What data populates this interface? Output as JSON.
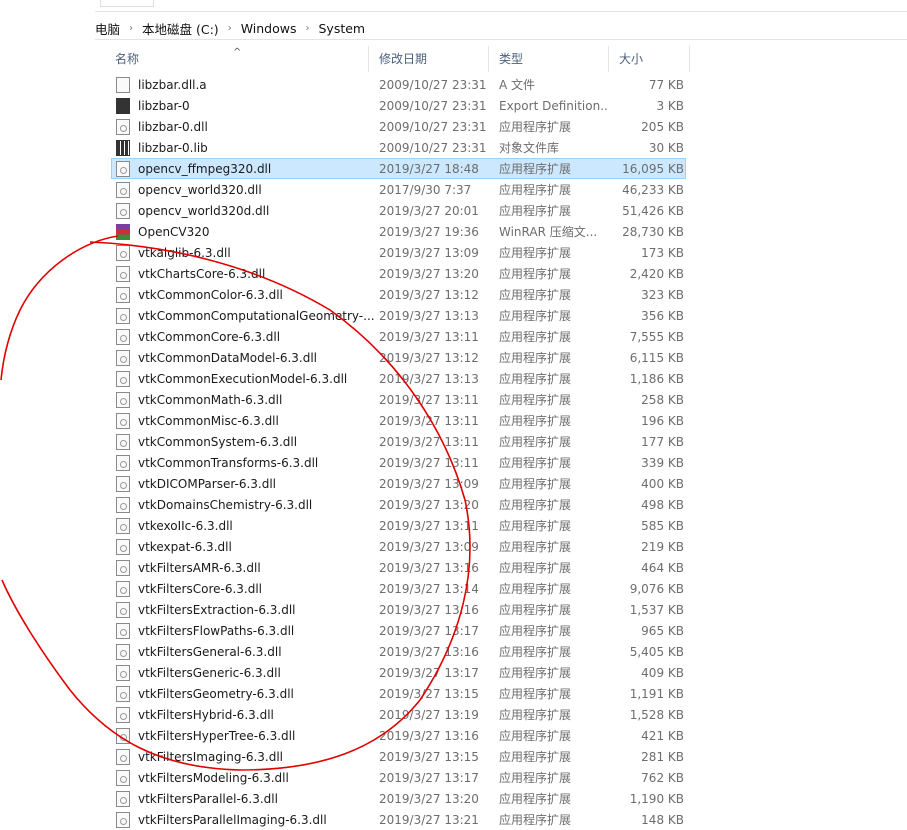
{
  "breadcrumb": [
    "电脑",
    "本地磁盘 (C:)",
    "Windows",
    "System"
  ],
  "columns": {
    "name": "名称",
    "date": "修改日期",
    "type": "类型",
    "size": "大小"
  },
  "files": [
    {
      "name": "libzbar.dll.a",
      "date": "2009/10/27 23:31",
      "type": "A 文件",
      "size": "77 KB",
      "icon": "file"
    },
    {
      "name": "libzbar-0",
      "date": "2009/10/27 23:31",
      "type": "Export Definition...",
      "size": "3 KB",
      "icon": "def"
    },
    {
      "name": "libzbar-0.dll",
      "date": "2009/10/27 23:31",
      "type": "应用程序扩展",
      "size": "205 KB",
      "icon": "dll"
    },
    {
      "name": "libzbar-0.lib",
      "date": "2009/10/27 23:31",
      "type": "对象文件库",
      "size": "30 KB",
      "icon": "lib"
    },
    {
      "name": "opencv_ffmpeg320.dll",
      "date": "2019/3/27 18:48",
      "type": "应用程序扩展",
      "size": "16,095 KB",
      "icon": "dll",
      "selected": true
    },
    {
      "name": "opencv_world320.dll",
      "date": "2017/9/30 7:37",
      "type": "应用程序扩展",
      "size": "46,233 KB",
      "icon": "dll"
    },
    {
      "name": "opencv_world320d.dll",
      "date": "2019/3/27 20:01",
      "type": "应用程序扩展",
      "size": "51,426 KB",
      "icon": "dll"
    },
    {
      "name": "OpenCV320",
      "date": "2019/3/27 19:36",
      "type": "WinRAR 压缩文...",
      "size": "28,730 KB",
      "icon": "rar"
    },
    {
      "name": "vtkalglib-6.3.dll",
      "date": "2019/3/27 13:09",
      "type": "应用程序扩展",
      "size": "173 KB",
      "icon": "dll"
    },
    {
      "name": "vtkChartsCore-6.3.dll",
      "date": "2019/3/27 13:20",
      "type": "应用程序扩展",
      "size": "2,420 KB",
      "icon": "dll"
    },
    {
      "name": "vtkCommonColor-6.3.dll",
      "date": "2019/3/27 13:12",
      "type": "应用程序扩展",
      "size": "323 KB",
      "icon": "dll"
    },
    {
      "name": "vtkCommonComputationalGeometry-...",
      "date": "2019/3/27 13:13",
      "type": "应用程序扩展",
      "size": "356 KB",
      "icon": "dll"
    },
    {
      "name": "vtkCommonCore-6.3.dll",
      "date": "2019/3/27 13:11",
      "type": "应用程序扩展",
      "size": "7,555 KB",
      "icon": "dll"
    },
    {
      "name": "vtkCommonDataModel-6.3.dll",
      "date": "2019/3/27 13:12",
      "type": "应用程序扩展",
      "size": "6,115 KB",
      "icon": "dll"
    },
    {
      "name": "vtkCommonExecutionModel-6.3.dll",
      "date": "2019/3/27 13:13",
      "type": "应用程序扩展",
      "size": "1,186 KB",
      "icon": "dll"
    },
    {
      "name": "vtkCommonMath-6.3.dll",
      "date": "2019/3/27 13:11",
      "type": "应用程序扩展",
      "size": "258 KB",
      "icon": "dll"
    },
    {
      "name": "vtkCommonMisc-6.3.dll",
      "date": "2019/3/27 13:11",
      "type": "应用程序扩展",
      "size": "196 KB",
      "icon": "dll"
    },
    {
      "name": "vtkCommonSystem-6.3.dll",
      "date": "2019/3/27 13:11",
      "type": "应用程序扩展",
      "size": "177 KB",
      "icon": "dll"
    },
    {
      "name": "vtkCommonTransforms-6.3.dll",
      "date": "2019/3/27 13:11",
      "type": "应用程序扩展",
      "size": "339 KB",
      "icon": "dll"
    },
    {
      "name": "vtkDICOMParser-6.3.dll",
      "date": "2019/3/27 13:09",
      "type": "应用程序扩展",
      "size": "400 KB",
      "icon": "dll"
    },
    {
      "name": "vtkDomainsChemistry-6.3.dll",
      "date": "2019/3/27 13:20",
      "type": "应用程序扩展",
      "size": "498 KB",
      "icon": "dll"
    },
    {
      "name": "vtkexoIIc-6.3.dll",
      "date": "2019/3/27 13:11",
      "type": "应用程序扩展",
      "size": "585 KB",
      "icon": "dll"
    },
    {
      "name": "vtkexpat-6.3.dll",
      "date": "2019/3/27 13:09",
      "type": "应用程序扩展",
      "size": "219 KB",
      "icon": "dll"
    },
    {
      "name": "vtkFiltersAMR-6.3.dll",
      "date": "2019/3/27 13:16",
      "type": "应用程序扩展",
      "size": "464 KB",
      "icon": "dll"
    },
    {
      "name": "vtkFiltersCore-6.3.dll",
      "date": "2019/3/27 13:14",
      "type": "应用程序扩展",
      "size": "9,076 KB",
      "icon": "dll"
    },
    {
      "name": "vtkFiltersExtraction-6.3.dll",
      "date": "2019/3/27 13:16",
      "type": "应用程序扩展",
      "size": "1,537 KB",
      "icon": "dll"
    },
    {
      "name": "vtkFiltersFlowPaths-6.3.dll",
      "date": "2019/3/27 13:17",
      "type": "应用程序扩展",
      "size": "965 KB",
      "icon": "dll"
    },
    {
      "name": "vtkFiltersGeneral-6.3.dll",
      "date": "2019/3/27 13:16",
      "type": "应用程序扩展",
      "size": "5,405 KB",
      "icon": "dll"
    },
    {
      "name": "vtkFiltersGeneric-6.3.dll",
      "date": "2019/3/27 13:17",
      "type": "应用程序扩展",
      "size": "409 KB",
      "icon": "dll"
    },
    {
      "name": "vtkFiltersGeometry-6.3.dll",
      "date": "2019/3/27 13:15",
      "type": "应用程序扩展",
      "size": "1,191 KB",
      "icon": "dll"
    },
    {
      "name": "vtkFiltersHybrid-6.3.dll",
      "date": "2019/3/27 13:19",
      "type": "应用程序扩展",
      "size": "1,528 KB",
      "icon": "dll"
    },
    {
      "name": "vtkFiltersHyperTree-6.3.dll",
      "date": "2019/3/27 13:16",
      "type": "应用程序扩展",
      "size": "421 KB",
      "icon": "dll"
    },
    {
      "name": "vtkFiltersImaging-6.3.dll",
      "date": "2019/3/27 13:15",
      "type": "应用程序扩展",
      "size": "281 KB",
      "icon": "dll"
    },
    {
      "name": "vtkFiltersModeling-6.3.dll",
      "date": "2019/3/27 13:17",
      "type": "应用程序扩展",
      "size": "762 KB",
      "icon": "dll"
    },
    {
      "name": "vtkFiltersParallel-6.3.dll",
      "date": "2019/3/27 13:20",
      "type": "应用程序扩展",
      "size": "1,190 KB",
      "icon": "dll"
    },
    {
      "name": "vtkFiltersParallelImaging-6.3.dll",
      "date": "2019/3/27 13:21",
      "type": "应用程序扩展",
      "size": "148 KB",
      "icon": "dll"
    }
  ],
  "colors": {
    "selection": "#cce8ff",
    "annotation": "#e00000"
  }
}
